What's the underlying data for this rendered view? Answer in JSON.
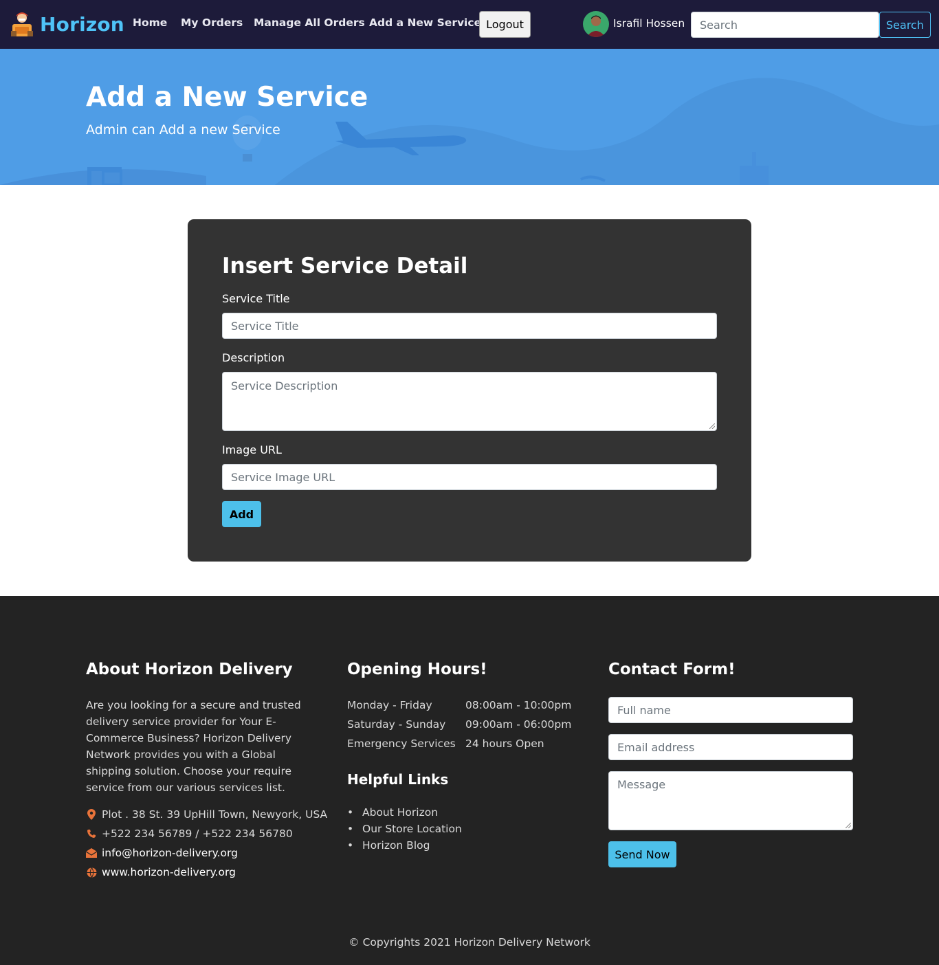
{
  "navbar": {
    "brand": "Horizon",
    "links": [
      "Home",
      "My Orders",
      "Manage All Orders",
      "Add a New Service"
    ],
    "logout_label": "Logout",
    "user_name": "Israfil Hossen",
    "search_placeholder": "Search",
    "search_button": "Search"
  },
  "hero": {
    "title": "Add a New Service",
    "subtitle": "Admin can Add a new Service"
  },
  "form": {
    "title": "Insert Service Detail",
    "title_label": "Service Title",
    "title_placeholder": "Service Title",
    "description_label": "Description",
    "description_placeholder": "Service Description",
    "image_label": "Image URL",
    "image_placeholder": "Service Image URL",
    "add_button": "Add"
  },
  "footer": {
    "about_heading": "About Horizon Delivery",
    "about_text": "Are you looking for a secure and trusted delivery service provider for Your E-Commerce Business? Horizon Delivery Network provides you with a Global shipping solution. Choose your require service from our various services list.",
    "address": "Plot . 38 St. 39 UpHill Town, Newyork, USA",
    "phone": "+522 234 56789 / +522 234 56780",
    "email": "info@horizon-delivery.org",
    "website": "www.horizon-delivery.org",
    "hours_heading": "Opening Hours!",
    "hours": [
      {
        "day": "Monday - Friday",
        "time": "08:00am - 10:00pm"
      },
      {
        "day": "Saturday - Sunday",
        "time": "09:00am - 06:00pm"
      },
      {
        "day": "Emergency Services",
        "time": "24 hours Open"
      }
    ],
    "links_heading": "Helpful Links",
    "links": [
      "About Horizon",
      "Our Store Location",
      "Horizon Blog"
    ],
    "contact_heading": "Contact Form!",
    "name_placeholder": "Full name",
    "email_placeholder": "Email address",
    "message_placeholder": "Message",
    "send_button": "Send Now",
    "copyright": "© Copyrights 2021 Horizon Delivery Network"
  },
  "colors": {
    "navbar_bg": "#1d1b3a",
    "brand": "#4fc3f7",
    "hero_bg": "#4f9de6",
    "card_bg": "#333333",
    "button_accent": "#4dc0ea",
    "footer_bg": "#232323",
    "icon_accent": "#e8733a"
  }
}
